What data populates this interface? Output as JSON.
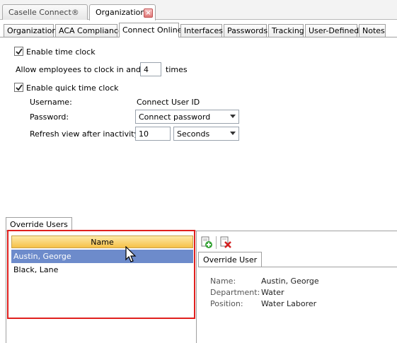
{
  "doc_tabs": [
    {
      "label": "Caselle Connect®"
    },
    {
      "label": "Organization"
    }
  ],
  "sub_tabs": [
    "Organization",
    "ACA Compliance",
    "Connect Online",
    "Interfaces",
    "Passwords",
    "Tracking",
    "User-Defined",
    "Notes"
  ],
  "form": {
    "enable_time_clock": {
      "label": "Enable time clock",
      "checked": true
    },
    "allow_clock_label": "Allow employees to clock in and out",
    "allow_clock_value": "4",
    "allow_clock_suffix": "times",
    "enable_quick_clock": {
      "label": "Enable quick time clock",
      "checked": true
    },
    "username_label": "Username:",
    "username_value": "Connect User ID",
    "password_label": "Password:",
    "password_value": "Connect password",
    "refresh_label": "Refresh view after inactivity:",
    "refresh_value": "10",
    "refresh_unit": "Seconds"
  },
  "override": {
    "tab_label": "Override Users",
    "grid_header": "Name",
    "rows": [
      {
        "name": "Austin, George",
        "selected": true
      },
      {
        "name": "Black, Lane",
        "selected": false
      }
    ],
    "toolbar": {
      "add_icon": "add-user-icon",
      "delete_icon": "delete-icon"
    },
    "detail_tab": "Override User",
    "details": {
      "name_label": "Name:",
      "name_value": "Austin, George",
      "department_label": "Department:",
      "department_value": "Water",
      "position_label": "Position:",
      "position_value": "Water Laborer"
    }
  },
  "colors": {
    "selection": "#6d8bcb",
    "header": "#f6c148",
    "highlight_box": "#e0201e"
  }
}
